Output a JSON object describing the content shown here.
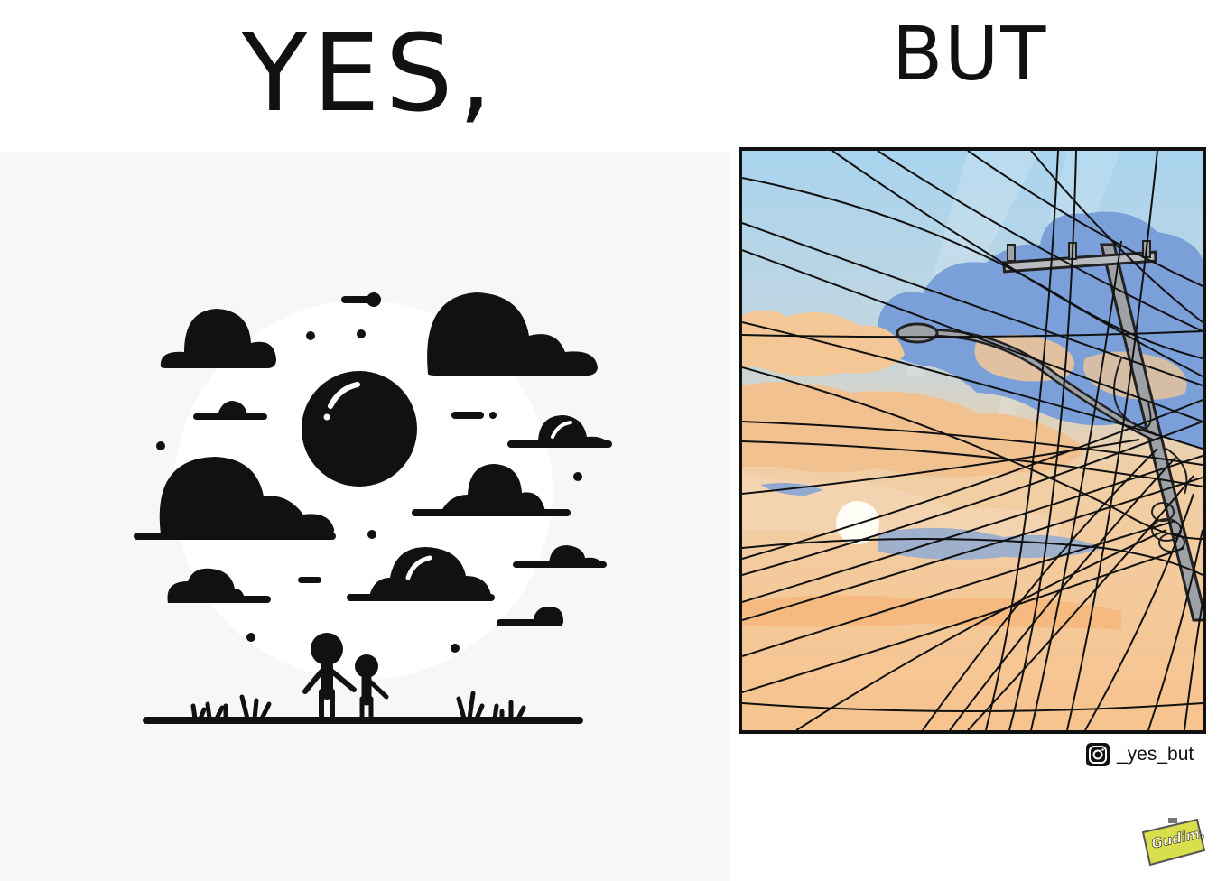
{
  "comic": {
    "left_caption": "YES,",
    "right_caption": "BUT",
    "credit": {
      "icon": "instagram-icon",
      "handle": "_yes_but"
    },
    "artist_signature": "Gudim."
  },
  "colors": {
    "ink": "#111111",
    "left_background": "#f6f7f7",
    "sky_top": "#a9d4ee",
    "sky_bottom": "#f7c38e",
    "cloud_blue": "#7b9fd8",
    "cloud_peach": "#f3c796",
    "logo_yellow": "#d8de4c"
  }
}
